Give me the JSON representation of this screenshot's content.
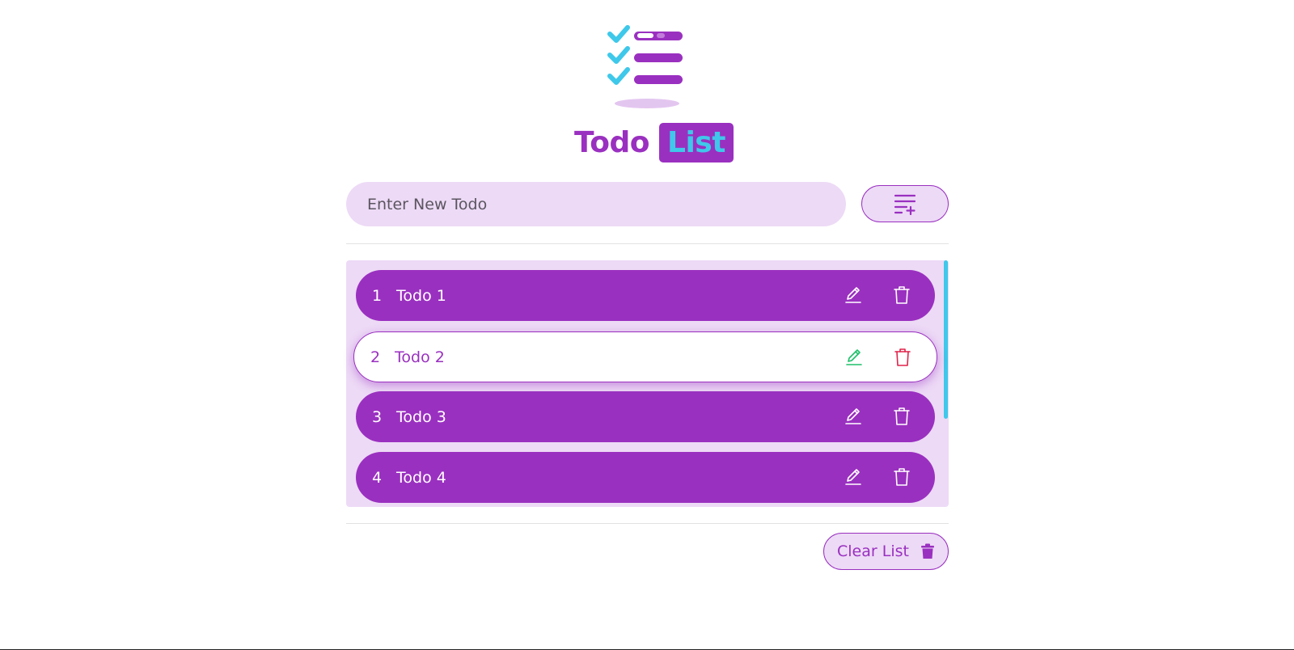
{
  "header": {
    "title_main": "Todo",
    "title_highlight": "List",
    "logo_icon": "checklist-logo-icon"
  },
  "input": {
    "placeholder": "Enter New Todo",
    "value": ""
  },
  "add_button": {
    "icon": "playlist-add-icon"
  },
  "todos": [
    {
      "num": "1",
      "text": "Todo 1"
    },
    {
      "num": "2",
      "text": "Todo 2"
    },
    {
      "num": "3",
      "text": "Todo 3"
    },
    {
      "num": "4",
      "text": "Todo 4"
    }
  ],
  "active_todo_index": 1,
  "footer": {
    "clear_label": "Clear List",
    "clear_icon": "trash-filled-icon"
  },
  "colors": {
    "primary": "#9a30c0",
    "accent": "#3ec8ea",
    "panel_bg": "#eddaf6",
    "edit_active": "#1fbf6a",
    "delete_active": "#e0224a"
  }
}
